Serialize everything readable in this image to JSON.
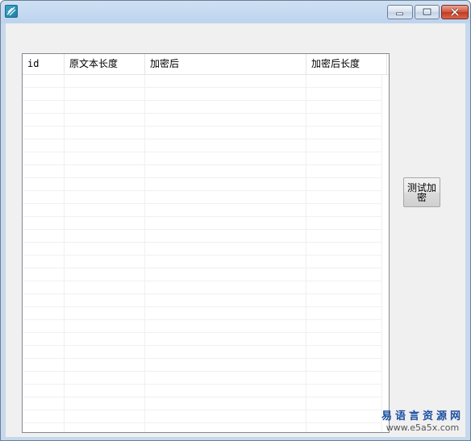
{
  "window": {
    "title": ""
  },
  "listview": {
    "columns": [
      {
        "label": "id"
      },
      {
        "label": "原文本长度"
      },
      {
        "label": "加密后"
      },
      {
        "label": "加密后长度"
      }
    ],
    "rows": []
  },
  "buttons": {
    "test_encrypt_label": "测试加密"
  },
  "watermark": {
    "site_name": "易语言资源网",
    "site_url": "www.e5a5x.com"
  },
  "colors": {
    "accent": "#1b4fa0",
    "close_button": "#c23a22"
  }
}
